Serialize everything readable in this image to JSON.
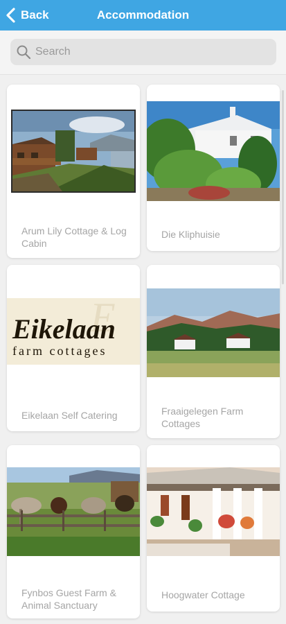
{
  "header": {
    "back_label": "Back",
    "title": "Accommodation"
  },
  "search": {
    "placeholder": "Search",
    "value": ""
  },
  "listings": [
    {
      "name": "Arum Lily Cottage & Log Cabin"
    },
    {
      "name": "Die Kliphuisie"
    },
    {
      "name": "Eikelaan Self Catering",
      "logo_title": "Eikelaan",
      "logo_subtitle": "farm cottages"
    },
    {
      "name": "Fraaigelegen Farm Cottages"
    },
    {
      "name": "Fynbos Guest Farm & Animal Sanctuary"
    },
    {
      "name": "Hoogwater Cottage"
    }
  ],
  "colors": {
    "header_bg": "#3fa6e3",
    "background": "#f0f0f0",
    "card_bg": "#ffffff",
    "label_text": "#a5a5a5"
  }
}
